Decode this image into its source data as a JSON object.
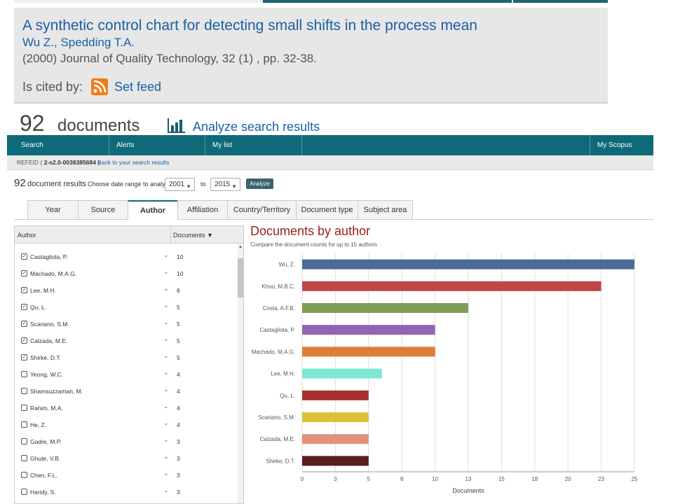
{
  "citation": {
    "title": "A synthetic control chart for detecting small shifts in the process mean",
    "authors": "Wu Z., Spedding T.A.",
    "source": "(2000) Journal of Quality Technology, 32 (1) , pp. 32-38.",
    "cited_by_label": "Is cited by:",
    "feed_label": "Set feed"
  },
  "results_header": {
    "count": "92",
    "label": "documents",
    "analyze_link": "Analyze search results"
  },
  "nav": {
    "items": [
      "Search",
      "Alerts",
      "My list",
      "My Scopus"
    ]
  },
  "subbar": {
    "refeid_prefix": "REFEID ( ",
    "refeid_value": "2-s2.0-0038385684",
    "refeid_suffix": " )",
    "back_link": "Back to your search results"
  },
  "analyze_bar": {
    "count": "92",
    "label": "document results",
    "range_label": "Choose date range to analyze:",
    "from_year": "2001",
    "to_label": "to",
    "to_year": "2015",
    "analyze_button": "Analyze"
  },
  "tabs": [
    {
      "label": "Year",
      "active": false
    },
    {
      "label": "Source",
      "active": false
    },
    {
      "label": "Author",
      "active": true
    },
    {
      "label": "Affiliation",
      "active": false
    },
    {
      "label": "Country/Territory",
      "active": false
    },
    {
      "label": "Document type",
      "active": false
    },
    {
      "label": "Subject area",
      "active": false
    }
  ],
  "author_table": {
    "col_author": "Author",
    "col_documents": "Documents",
    "sort_icon": "sort-icon",
    "rows": [
      {
        "name": "Castagliola, P.",
        "count": "10",
        "checked": true
      },
      {
        "name": "Machado, M.A.G.",
        "count": "10",
        "checked": true
      },
      {
        "name": "Lee, M.H.",
        "count": "6",
        "checked": true
      },
      {
        "name": "Qu, L.",
        "count": "5",
        "checked": true
      },
      {
        "name": "Scariano, S.M.",
        "count": "5",
        "checked": true
      },
      {
        "name": "Calzada, M.E.",
        "count": "5",
        "checked": true
      },
      {
        "name": "Shirke, D.T.",
        "count": "5",
        "checked": true
      },
      {
        "name": "Yeong, W.C.",
        "count": "4",
        "checked": false
      },
      {
        "name": "Shamsuzzaman, M.",
        "count": "4",
        "checked": false
      },
      {
        "name": "Rahim, M.A.",
        "count": "4",
        "checked": false
      },
      {
        "name": "He, Z.",
        "count": "4",
        "checked": false
      },
      {
        "name": "Gadre, M.P.",
        "count": "3",
        "checked": false
      },
      {
        "name": "Ghute, V.B.",
        "count": "3",
        "checked": false
      },
      {
        "name": "Chen, F.L.",
        "count": "3",
        "checked": false
      },
      {
        "name": "Haridy, S.",
        "count": "3",
        "checked": false
      }
    ]
  },
  "chart_data": {
    "type": "bar",
    "orientation": "horizontal",
    "title": "Documents by author",
    "subtitle": "Compare the document counts for up to 15 authors",
    "xlabel": "Documents",
    "ylabel": "",
    "xlim": [
      0,
      25
    ],
    "x_ticks": [
      "0",
      "3",
      "5",
      "8",
      "10",
      "13",
      "15",
      "18",
      "20",
      "23",
      "25"
    ],
    "categories": [
      "Wu, Z.",
      "Khoo, M.B.C.",
      "Costa, A.F.B.",
      "Castagliola, P.",
      "Machado, M.A.G.",
      "Lee, M.H.",
      "Qu, L.",
      "Scariano, S.M.",
      "Calzada, M.E.",
      "Shirke, D.T."
    ],
    "values": [
      25,
      22.5,
      12.5,
      10,
      10,
      6,
      5,
      5,
      5,
      5
    ],
    "colors": [
      "#4a6b96",
      "#c24646",
      "#7e9f55",
      "#9364b3",
      "#e07c3a",
      "#7ee8d4",
      "#a83030",
      "#d9c23a",
      "#e3927a",
      "#5a1c1c"
    ],
    "grid": true
  }
}
